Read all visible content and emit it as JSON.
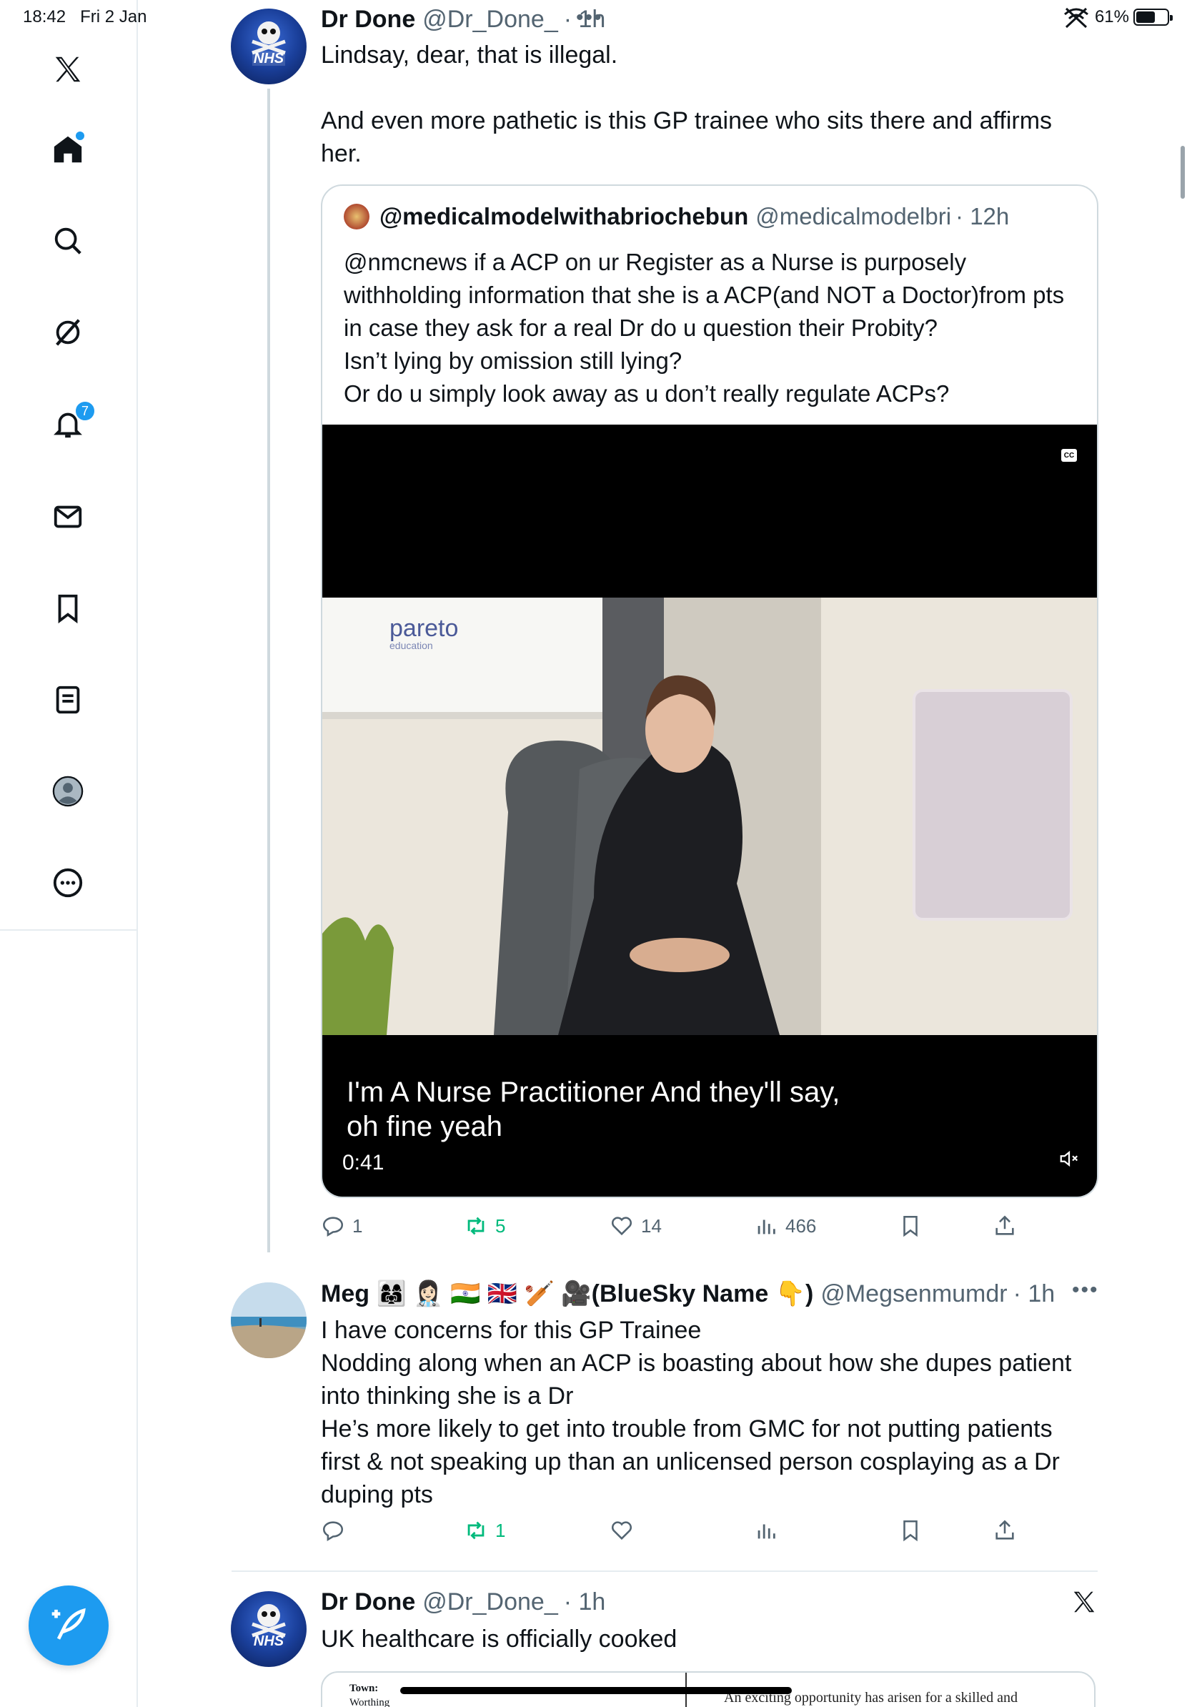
{
  "status_bar": {
    "time": "18:42",
    "date": "Fri 2 Jan",
    "battery": "61%",
    "battery_level": 0.61
  },
  "sidebar": {
    "notifications_count": "7"
  },
  "tweets": [
    {
      "name": "Dr Done",
      "handle": "@Dr_Done_",
      "time": "· 1h",
      "text": [
        "Lindsay, dear, that is illegal.",
        "",
        "And even more pathetic is this GP trainee who sits there and affirms her."
      ],
      "quote": {
        "name": "@medicalmodelwithabriochebun",
        "handle": "@medicalmodelbri",
        "time": "· 12h",
        "text": [
          "@nmcnews if a ACP on ur Register as a Nurse is purposely withholding information that she is a ACP(and NOT a Doctor)from pts in case they ask for a real Dr do u question their Probity?",
          "Isn’t lying by omission still lying?",
          "Or do u simply look away as u don’t really regulate ACPs?"
        ],
        "video": {
          "cc": "CC",
          "watermark": "pareto",
          "watermark_sub": "education",
          "caption": "I'm A Nurse Practitioner And they'll say, oh fine yeah",
          "duration": "0:41"
        }
      },
      "stats": {
        "replies": "1",
        "reposts": "5",
        "likes": "14",
        "views": "466"
      }
    },
    {
      "name": "Meg 👩‍👩‍👧 👩🏻‍⚕️ 🇮🇳 🇬🇧 🏏 🎥(BlueSky Name 👇)",
      "handle": "@Megsenmumdr",
      "time": "· 1h",
      "text": [
        "I have concerns for this GP Trainee",
        "Nodding along when an ACP is boasting about how she dupes patient into thinking she is a Dr",
        "He’s more likely to get into trouble from GMC for not putting patients first & not speaking up than an unlicensed person cosplaying as a Dr duping pts"
      ],
      "stats": {
        "reposts": "1"
      }
    },
    {
      "name": "Dr Done",
      "handle": "@Dr_Done_",
      "time": "· 1h",
      "text": [
        "UK healthcare is officially cooked"
      ],
      "media": {
        "town_label": "Town:",
        "town_value": "Worthing",
        "snippet": "An exciting opportunity has arisen for a skilled and"
      }
    }
  ],
  "avatar_label": "NHS",
  "colors": {
    "accent": "#1d9bf0",
    "repost": "#00ba7c",
    "secondary_text": "#536471",
    "border": "#cfd9de"
  }
}
